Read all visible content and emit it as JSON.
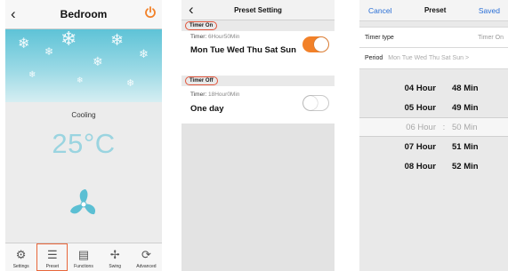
{
  "screen1": {
    "title": "Bedroom",
    "back_icon": "back-chevron-icon",
    "power_icon": "power-icon",
    "mode": "Cooling",
    "temperature": "25°C",
    "accent": "#f28129",
    "tabs": [
      {
        "label": "Settings",
        "icon": "gear-icon"
      },
      {
        "label": "Preset",
        "icon": "list-icon"
      },
      {
        "label": "Functions",
        "icon": "document-icon"
      },
      {
        "label": "Swing",
        "icon": "swing-icon"
      },
      {
        "label": "Advanced",
        "icon": "advanced-icon"
      }
    ],
    "active_tab": "Preset"
  },
  "screen2": {
    "title": "Preset Setting",
    "timer_on": {
      "section": "Timer On",
      "timer_label": "Timer:",
      "timer_value": "6Hour50Min",
      "days": "Mon Tue Wed Thu Sat Sun",
      "enabled": true
    },
    "timer_off": {
      "section": "Timer Off",
      "timer_label": "Timer:",
      "timer_value": "18Hour0Min",
      "days": "One day",
      "enabled": false
    }
  },
  "screen3": {
    "cancel": "Cancel",
    "title": "Preset",
    "saved": "Saved",
    "timer_type_label": "Timer type",
    "timer_type_value": "Timer On",
    "period_label": "Period",
    "period_days": [
      "Mon",
      "Tue",
      "Wed",
      "Thu",
      "Sat",
      "Sun"
    ],
    "chevron": ">",
    "picker": [
      {
        "hour": "04 Hour",
        "min": "48 Min"
      },
      {
        "hour": "05 Hour",
        "min": "49 Min"
      },
      {
        "hour": "06 Hour",
        "min": "50 Min"
      },
      {
        "hour": "07 Hour",
        "min": "51 Min"
      },
      {
        "hour": "08 Hour",
        "min": "52 Min"
      }
    ],
    "picker_separator": ":",
    "selected_index": 2
  }
}
